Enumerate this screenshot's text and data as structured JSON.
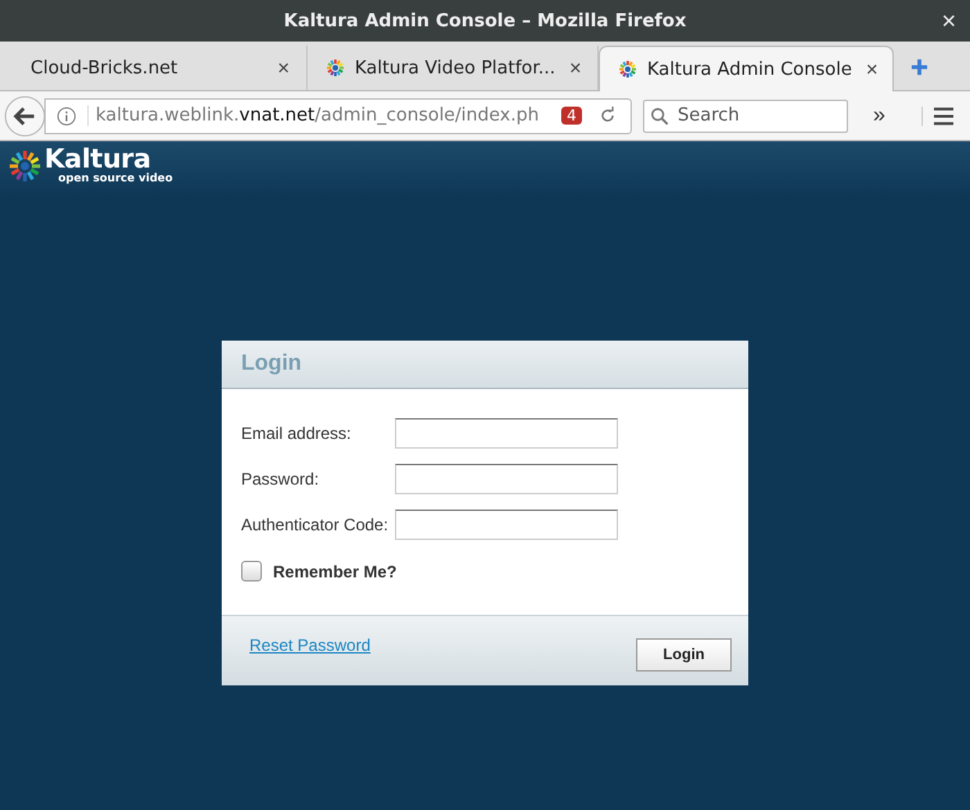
{
  "window": {
    "title": "Kaltura Admin Console – Mozilla Firefox",
    "close": "×"
  },
  "tabs": [
    {
      "label": "Cloud-Bricks.net",
      "selected": false,
      "favicon": false,
      "close": "×"
    },
    {
      "label": "Kaltura Video Platfor...",
      "selected": false,
      "favicon": true,
      "close": "×"
    },
    {
      "label": "Kaltura Admin Console",
      "selected": true,
      "favicon": true,
      "close": "×"
    }
  ],
  "toolbar": {
    "url": "kaltura.weblink.**vnat.net**/admin_console/index.ph",
    "badge": "4",
    "search": {
      "placeholder": "Search"
    },
    "overflow": "»"
  },
  "logo": {
    "name": "Kaltura",
    "tagline": "open source video"
  },
  "login": {
    "title": "Login",
    "fields": [
      {
        "label": "Email address:"
      },
      {
        "label": "Password:"
      },
      {
        "label": "Authenticator Code:"
      }
    ],
    "remember": {
      "label": "Remember Me?",
      "checked": false
    },
    "reset_link": "Reset Password",
    "button": "Login"
  }
}
